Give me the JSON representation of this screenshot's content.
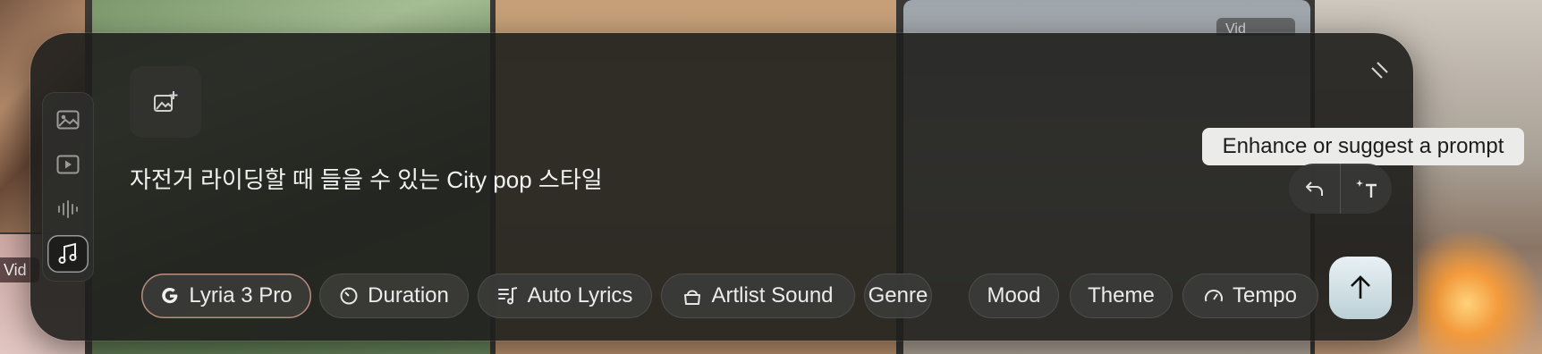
{
  "background": {
    "badge_left": "Vid",
    "badge_right": "Vid"
  },
  "composer": {
    "prompt_text": "자전거 라이딩할 때 들을 수 있는 City pop 스타일",
    "tooltip": "Enhance or suggest a prompt",
    "mode_rail": [
      {
        "icon": "image-icon",
        "active": false
      },
      {
        "icon": "video-icon",
        "active": false
      },
      {
        "icon": "audio-waveform-icon",
        "active": false
      },
      {
        "icon": "music-note-icon",
        "active": true
      }
    ],
    "options": [
      {
        "label": "Lyria 3 Pro",
        "icon": "google-g-icon"
      },
      {
        "label": "Duration",
        "icon": "timer-icon"
      },
      {
        "label": "Auto Lyrics",
        "icon": "lyrics-icon"
      },
      {
        "label": "Artlist Sound",
        "icon": "bag-icon"
      },
      {
        "label": "Genre",
        "icon": ""
      },
      {
        "label": "Mood",
        "icon": ""
      },
      {
        "label": "Theme",
        "icon": ""
      },
      {
        "label": "Tempo",
        "icon": "speedometer-icon"
      }
    ]
  }
}
